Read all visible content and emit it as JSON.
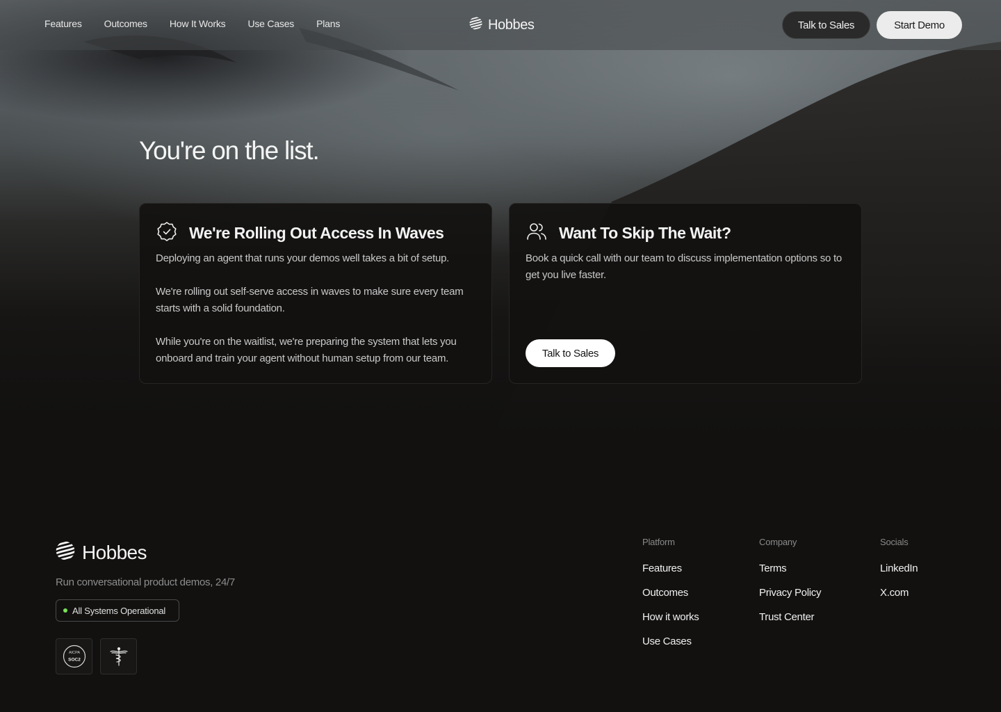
{
  "nav": {
    "links": [
      "Features",
      "Outcomes",
      "How It Works",
      "Use Cases",
      "Plans"
    ],
    "brand": "Hobbes",
    "talk_to_sales": "Talk to Sales",
    "start_demo": "Start Demo"
  },
  "hero": {
    "title": "You're on the list."
  },
  "cards": [
    {
      "title": "We're Rolling Out Access In Waves",
      "icon": "badge-check-icon",
      "paragraphs": [
        "Deploying an agent that runs your demos well takes a bit of setup.",
        "We're rolling out self-serve access in waves to make sure every team starts with a solid foundation.",
        "While you're on the waitlist, we're preparing the system that lets you onboard and train your agent without human setup from our team."
      ]
    },
    {
      "title": "Want To Skip The Wait?",
      "icon": "users-icon",
      "paragraphs": [
        "Book a quick call with our team to discuss implementation options so to get you live faster."
      ],
      "button": "Talk to Sales"
    }
  ],
  "footer": {
    "brand": "Hobbes",
    "tagline": "Run conversational product demos, 24/7",
    "status": "All Systems Operational",
    "status_color": "#7be05a",
    "badge_soc2": {
      "top": "AICPA",
      "bottom": "SOC2"
    },
    "columns": [
      {
        "heading": "Platform",
        "links": [
          "Features",
          "Outcomes",
          "How it works",
          "Use Cases"
        ]
      },
      {
        "heading": "Company",
        "links": [
          "Terms",
          "Privacy Policy",
          "Trust Center"
        ]
      },
      {
        "heading": "Socials",
        "links": [
          "LinkedIn",
          "X.com"
        ]
      }
    ]
  }
}
